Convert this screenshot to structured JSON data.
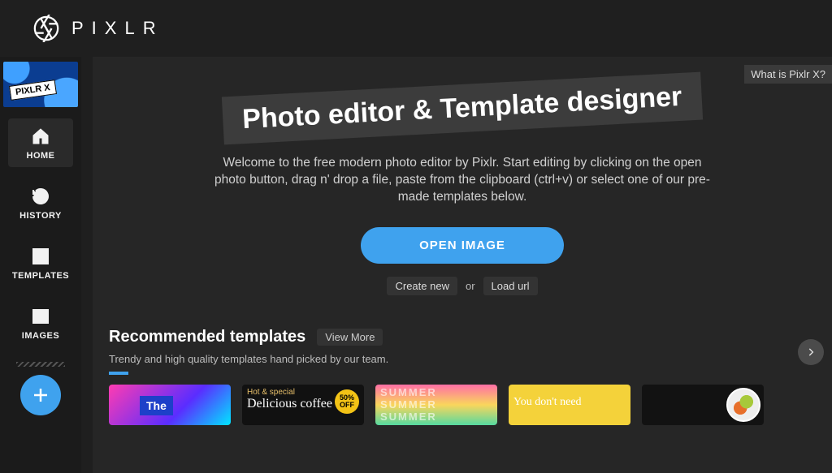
{
  "brand": {
    "name": "PIXLR"
  },
  "sidebar": {
    "thumb_tag": "PIXLR X",
    "items": [
      {
        "label": "HOME"
      },
      {
        "label": "HISTORY"
      },
      {
        "label": "TEMPLATES"
      },
      {
        "label": "IMAGES"
      }
    ]
  },
  "hero": {
    "help": "What is Pixlr X?",
    "headline": "Photo editor & Template designer",
    "welcome": "Welcome to the free modern photo editor by Pixlr. Start editing by clicking on the open photo button, drag n' drop a file, paste from the clipboard (ctrl+v) or select one of our pre-made templates below.",
    "open_button": "OPEN IMAGE",
    "create_new": "Create new",
    "or": "or",
    "load_url": "Load url"
  },
  "reco": {
    "title": "Recommended templates",
    "view_more": "View More",
    "subtitle": "Trendy and high quality templates hand picked by our team.",
    "cards": {
      "c1_label": "The",
      "c2_top": "Hot & special",
      "c2_title": "Delicious coffee",
      "c2_badge_top": "50%",
      "c2_badge_bot": "OFF",
      "c3_word": "SUMMER",
      "c4_text": "You don't need"
    }
  }
}
